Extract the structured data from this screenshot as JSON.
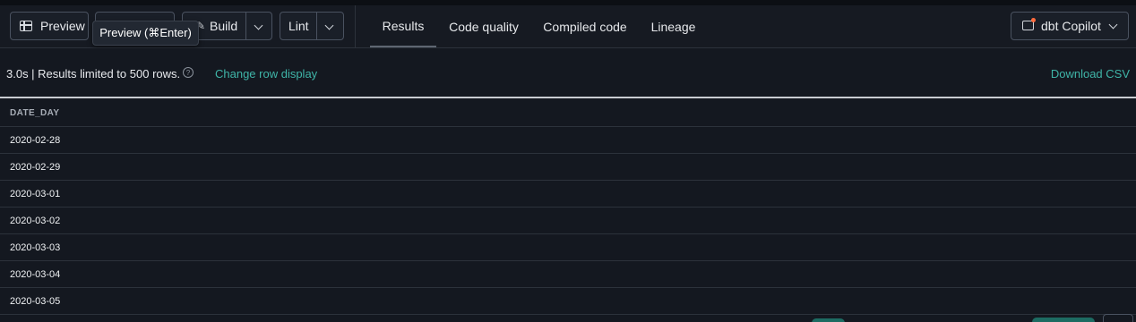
{
  "toolbar": {
    "preview_label": "Preview",
    "compile_label": "",
    "build_label": "Build",
    "lint_label": "Lint",
    "copilot_label": "dbt Copilot"
  },
  "tooltip": {
    "text": "Preview (⌘Enter)"
  },
  "tabs": [
    {
      "label": "Results",
      "active": true
    },
    {
      "label": "Code quality",
      "active": false
    },
    {
      "label": "Compiled code",
      "active": false
    },
    {
      "label": "Lineage",
      "active": false
    }
  ],
  "status": {
    "meta_text": "3.0s | Results limited to 500 rows.",
    "help_glyph": "?",
    "change_row_display": "Change row display",
    "download_csv": "Download CSV"
  },
  "table": {
    "columns": [
      "DATE_DAY"
    ],
    "rows": [
      "2020-02-28",
      "2020-02-29",
      "2020-03-01",
      "2020-03-02",
      "2020-03-03",
      "2020-03-04",
      "2020-03-05"
    ]
  },
  "colors": {
    "accent_link": "#3fb5a8",
    "background": "#141820",
    "copilot_dot": "#ff6b3d"
  }
}
